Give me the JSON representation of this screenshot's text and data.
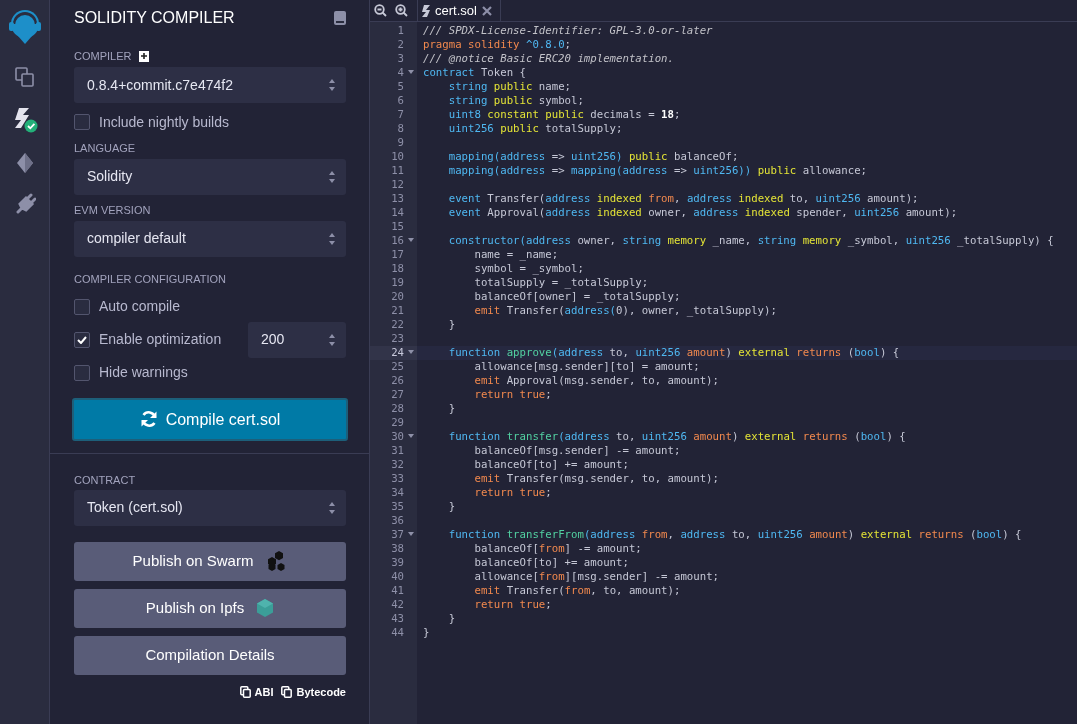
{
  "panel": {
    "title": "SOLIDITY COMPILER",
    "compiler": {
      "label": "COMPILER",
      "value": "0.8.4+commit.c7e474f2"
    },
    "nightly": {
      "label": "Include nightly builds",
      "checked": false
    },
    "language": {
      "label": "LANGUAGE",
      "value": "Solidity"
    },
    "evm": {
      "label": "EVM VERSION",
      "value": "compiler default"
    },
    "config": {
      "label": "COMPILER CONFIGURATION",
      "options": [
        {
          "label": "Auto compile",
          "checked": false,
          "kind": "plain"
        },
        {
          "label": "Enable optimization",
          "checked": true,
          "kind": "runs",
          "runs": "200"
        },
        {
          "label": "Hide warnings",
          "checked": false,
          "kind": "plain"
        }
      ]
    },
    "compile_button": "Compile cert.sol",
    "contract": {
      "label": "CONTRACT",
      "value": "Token (cert.sol)"
    },
    "actions": [
      {
        "label": "Publish on Swarm",
        "kind": "swarm"
      },
      {
        "label": "Publish on Ipfs",
        "kind": "ipfs"
      },
      {
        "label": "Compilation Details",
        "kind": "plain"
      }
    ],
    "copy_links": [
      "ABI",
      "Bytecode"
    ]
  },
  "editor": {
    "tab": {
      "title": "cert.sol"
    },
    "lines": [
      {
        "number": "1",
        "foldable": false,
        "current": false,
        "tokens": [
          {
            "kind": "comment",
            "text": "/// SPDX-License-Identifier: GPL-3.0-or-later"
          }
        ]
      },
      {
        "number": "2",
        "foldable": false,
        "current": false,
        "tokens": [
          {
            "kind": "keyword",
            "text": "pragma solidity"
          },
          {
            "kind": "type",
            "text": " ^0.8.0"
          },
          {
            "kind": "plain",
            "text": ";"
          }
        ]
      },
      {
        "number": "3",
        "foldable": false,
        "current": false,
        "tokens": [
          {
            "kind": "comment",
            "text": "/// @notice Basic ERC20 implementation."
          }
        ]
      },
      {
        "number": "4",
        "foldable": true,
        "current": false,
        "tokens": [
          {
            "kind": "type",
            "text": "contract"
          },
          {
            "kind": "plain",
            "text": " Token {"
          }
        ]
      },
      {
        "number": "5",
        "foldable": false,
        "current": false,
        "tokens": [
          {
            "kind": "type",
            "text": "    string"
          },
          {
            "kind": "modifier",
            "text": " public"
          },
          {
            "kind": "plain",
            "text": " name;"
          }
        ]
      },
      {
        "number": "6",
        "foldable": false,
        "current": false,
        "tokens": [
          {
            "kind": "type",
            "text": "    string"
          },
          {
            "kind": "modifier",
            "text": " public"
          },
          {
            "kind": "plain",
            "text": " symbol;"
          }
        ]
      },
      {
        "number": "7",
        "foldable": false,
        "current": false,
        "tokens": [
          {
            "kind": "type",
            "text": "    uint8"
          },
          {
            "kind": "modifier",
            "text": " constant public"
          },
          {
            "kind": "plain",
            "text": " decimals = "
          },
          {
            "kind": "number",
            "text": "18"
          },
          {
            "kind": "plain",
            "text": ";"
          }
        ]
      },
      {
        "number": "8",
        "foldable": false,
        "current": false,
        "tokens": [
          {
            "kind": "type",
            "text": "    uint256"
          },
          {
            "kind": "modifier",
            "text": " public"
          },
          {
            "kind": "plain",
            "text": " totalSupply;"
          }
        ]
      },
      {
        "number": "9",
        "foldable": false,
        "current": false
      },
      {
        "number": "10",
        "foldable": false,
        "current": false,
        "tokens": [
          {
            "kind": "type",
            "text": "    mapping(address"
          },
          {
            "kind": "plain",
            "text": " => "
          },
          {
            "kind": "type",
            "text": "uint256)"
          },
          {
            "kind": "modifier",
            "text": " public"
          },
          {
            "kind": "plain",
            "text": " balanceOf;"
          }
        ]
      },
      {
        "number": "11",
        "foldable": false,
        "current": false,
        "tokens": [
          {
            "kind": "type",
            "text": "    mapping(address"
          },
          {
            "kind": "plain",
            "text": " => "
          },
          {
            "kind": "type",
            "text": "mapping(address"
          },
          {
            "kind": "plain",
            "text": " => "
          },
          {
            "kind": "type",
            "text": "uint256))"
          },
          {
            "kind": "modifier",
            "text": " public"
          },
          {
            "kind": "plain",
            "text": " allowance;"
          }
        ]
      },
      {
        "number": "12",
        "foldable": false,
        "current": false
      },
      {
        "number": "13",
        "foldable": false,
        "current": false,
        "tokens": [
          {
            "kind": "type",
            "text": "    event"
          },
          {
            "kind": "plain",
            "text": " Transfer("
          },
          {
            "kind": "type",
            "text": "address"
          },
          {
            "kind": "modifier",
            "text": " indexed"
          },
          {
            "kind": "keyword",
            "text": " from"
          },
          {
            "kind": "plain",
            "text": ", "
          },
          {
            "kind": "type",
            "text": "address"
          },
          {
            "kind": "modifier",
            "text": " indexed"
          },
          {
            "kind": "plain",
            "text": " to, "
          },
          {
            "kind": "type",
            "text": "uint256"
          },
          {
            "kind": "plain",
            "text": " amount);"
          }
        ]
      },
      {
        "number": "14",
        "foldable": false,
        "current": false,
        "tokens": [
          {
            "kind": "type",
            "text": "    event"
          },
          {
            "kind": "plain",
            "text": " Approval("
          },
          {
            "kind": "type",
            "text": "address"
          },
          {
            "kind": "modifier",
            "text": " indexed"
          },
          {
            "kind": "plain",
            "text": " owner, "
          },
          {
            "kind": "type",
            "text": "address"
          },
          {
            "kind": "modifier",
            "text": " indexed"
          },
          {
            "kind": "plain",
            "text": " spender, "
          },
          {
            "kind": "type",
            "text": "uint256"
          },
          {
            "kind": "plain",
            "text": " amount);"
          }
        ]
      },
      {
        "number": "15",
        "foldable": false,
        "current": false
      },
      {
        "number": "16",
        "foldable": true,
        "current": false,
        "tokens": [
          {
            "kind": "type",
            "text": "    constructor(address"
          },
          {
            "kind": "plain",
            "text": " owner, "
          },
          {
            "kind": "type",
            "text": "string"
          },
          {
            "kind": "modifier",
            "text": " memory"
          },
          {
            "kind": "plain",
            "text": " _name, "
          },
          {
            "kind": "type",
            "text": "string"
          },
          {
            "kind": "modifier",
            "text": " memory"
          },
          {
            "kind": "plain",
            "text": " _symbol, "
          },
          {
            "kind": "type",
            "text": "uint256"
          },
          {
            "kind": "plain",
            "text": " _totalSupply) {"
          }
        ]
      },
      {
        "number": "17",
        "foldable": false,
        "current": false,
        "tokens": [
          {
            "kind": "plain",
            "text": "        name = _name;"
          }
        ]
      },
      {
        "number": "18",
        "foldable": false,
        "current": false,
        "tokens": [
          {
            "kind": "plain",
            "text": "        symbol = _symbol;"
          }
        ]
      },
      {
        "number": "19",
        "foldable": false,
        "current": false,
        "tokens": [
          {
            "kind": "plain",
            "text": "        totalSupply = _totalSupply;"
          }
        ]
      },
      {
        "number": "20",
        "foldable": false,
        "current": false,
        "tokens": [
          {
            "kind": "plain",
            "text": "        balanceOf[owner] = _totalSupply;"
          }
        ]
      },
      {
        "number": "21",
        "foldable": false,
        "current": false,
        "tokens": [
          {
            "kind": "keyword",
            "text": "        emit"
          },
          {
            "kind": "plain",
            "text": " Transfer("
          },
          {
            "kind": "type",
            "text": "address("
          },
          {
            "kind": "plain",
            "text": "0), owner, _totalSupply);"
          }
        ]
      },
      {
        "number": "22",
        "foldable": false,
        "current": false,
        "tokens": [
          {
            "kind": "plain",
            "text": "    }"
          }
        ]
      },
      {
        "number": "23",
        "foldable": false,
        "current": false
      },
      {
        "number": "24",
        "foldable": true,
        "current": true,
        "tokens": [
          {
            "kind": "type",
            "text": "    function"
          },
          {
            "kind": "name",
            "text": " approve"
          },
          {
            "kind": "type",
            "text": "(address"
          },
          {
            "kind": "plain",
            "text": " to, "
          },
          {
            "kind": "type",
            "text": "uint256"
          },
          {
            "kind": "keyword",
            "text": " amount"
          },
          {
            "kind": "plain",
            "text": ") "
          },
          {
            "kind": "modifier",
            "text": "external"
          },
          {
            "kind": "keyword",
            "text": " returns"
          },
          {
            "kind": "plain",
            "text": " ("
          },
          {
            "kind": "type",
            "text": "bool"
          },
          {
            "kind": "plain",
            "text": ") {"
          }
        ]
      },
      {
        "number": "25",
        "foldable": false,
        "current": false,
        "tokens": [
          {
            "kind": "plain",
            "text": "        allowance[msg.sender][to] = amount;"
          }
        ]
      },
      {
        "number": "26",
        "foldable": false,
        "current": false,
        "tokens": [
          {
            "kind": "keyword",
            "text": "        emit"
          },
          {
            "kind": "plain",
            "text": " Approval(msg.sender, to, amount);"
          }
        ]
      },
      {
        "number": "27",
        "foldable": false,
        "current": false,
        "tokens": [
          {
            "kind": "keyword",
            "text": "        return true"
          },
          {
            "kind": "plain",
            "text": ";"
          }
        ]
      },
      {
        "number": "28",
        "foldable": false,
        "current": false,
        "tokens": [
          {
            "kind": "plain",
            "text": "    }"
          }
        ]
      },
      {
        "number": "29",
        "foldable": false,
        "current": false
      },
      {
        "number": "30",
        "foldable": true,
        "current": false,
        "tokens": [
          {
            "kind": "type",
            "text": "    function"
          },
          {
            "kind": "name",
            "text": " transfer"
          },
          {
            "kind": "type",
            "text": "(address"
          },
          {
            "kind": "plain",
            "text": " to, "
          },
          {
            "kind": "type",
            "text": "uint256"
          },
          {
            "kind": "keyword",
            "text": " amount"
          },
          {
            "kind": "plain",
            "text": ") "
          },
          {
            "kind": "modifier",
            "text": "external"
          },
          {
            "kind": "keyword",
            "text": " returns"
          },
          {
            "kind": "plain",
            "text": " ("
          },
          {
            "kind": "type",
            "text": "bool"
          },
          {
            "kind": "plain",
            "text": ") {"
          }
        ]
      },
      {
        "number": "31",
        "foldable": false,
        "current": false,
        "tokens": [
          {
            "kind": "plain",
            "text": "        balanceOf[msg.sender] -= amount;"
          }
        ]
      },
      {
        "number": "32",
        "foldable": false,
        "current": false,
        "tokens": [
          {
            "kind": "plain",
            "text": "        balanceOf[to] += amount;"
          }
        ]
      },
      {
        "number": "33",
        "foldable": false,
        "current": false,
        "tokens": [
          {
            "kind": "keyword",
            "text": "        emit"
          },
          {
            "kind": "plain",
            "text": " Transfer(msg.sender, to, amount);"
          }
        ]
      },
      {
        "number": "34",
        "foldable": false,
        "current": false,
        "tokens": [
          {
            "kind": "keyword",
            "text": "        return true"
          },
          {
            "kind": "plain",
            "text": ";"
          }
        ]
      },
      {
        "number": "35",
        "foldable": false,
        "current": false,
        "tokens": [
          {
            "kind": "plain",
            "text": "    }"
          }
        ]
      },
      {
        "number": "36",
        "foldable": false,
        "current": false
      },
      {
        "number": "37",
        "foldable": true,
        "current": false,
        "tokens": [
          {
            "kind": "type",
            "text": "    function"
          },
          {
            "kind": "name",
            "text": " transferFrom"
          },
          {
            "kind": "type",
            "text": "(address"
          },
          {
            "kind": "keyword",
            "text": " from"
          },
          {
            "kind": "plain",
            "text": ", "
          },
          {
            "kind": "type",
            "text": "address"
          },
          {
            "kind": "plain",
            "text": " to, "
          },
          {
            "kind": "type",
            "text": "uint256"
          },
          {
            "kind": "keyword",
            "text": " amount"
          },
          {
            "kind": "plain",
            "text": ") "
          },
          {
            "kind": "modifier",
            "text": "external"
          },
          {
            "kind": "keyword",
            "text": " returns"
          },
          {
            "kind": "plain",
            "text": " ("
          },
          {
            "kind": "type",
            "text": "bool"
          },
          {
            "kind": "plain",
            "text": ") {"
          }
        ]
      },
      {
        "number": "38",
        "foldable": false,
        "current": false,
        "tokens": [
          {
            "kind": "plain",
            "text": "        balanceOf["
          },
          {
            "kind": "keyword",
            "text": "from"
          },
          {
            "kind": "plain",
            "text": "] -= amount;"
          }
        ]
      },
      {
        "number": "39",
        "foldable": false,
        "current": false,
        "tokens": [
          {
            "kind": "plain",
            "text": "        balanceOf[to] += amount;"
          }
        ]
      },
      {
        "number": "40",
        "foldable": false,
        "current": false,
        "tokens": [
          {
            "kind": "plain",
            "text": "        allowance["
          },
          {
            "kind": "keyword",
            "text": "from"
          },
          {
            "kind": "plain",
            "text": "][msg.sender] -= amount;"
          }
        ]
      },
      {
        "number": "41",
        "foldable": false,
        "current": false,
        "tokens": [
          {
            "kind": "keyword",
            "text": "        emit"
          },
          {
            "kind": "plain",
            "text": " Transfer("
          },
          {
            "kind": "keyword",
            "text": "from"
          },
          {
            "kind": "plain",
            "text": ", to, amount);"
          }
        ]
      },
      {
        "number": "42",
        "foldable": false,
        "current": false,
        "tokens": [
          {
            "kind": "keyword",
            "text": "        return true"
          },
          {
            "kind": "plain",
            "text": ";"
          }
        ]
      },
      {
        "number": "43",
        "foldable": false,
        "current": false,
        "tokens": [
          {
            "kind": "plain",
            "text": "    }"
          }
        ]
      },
      {
        "number": "44",
        "foldable": false,
        "current": false,
        "tokens": [
          {
            "kind": "plain",
            "text": "}"
          }
        ]
      }
    ]
  }
}
